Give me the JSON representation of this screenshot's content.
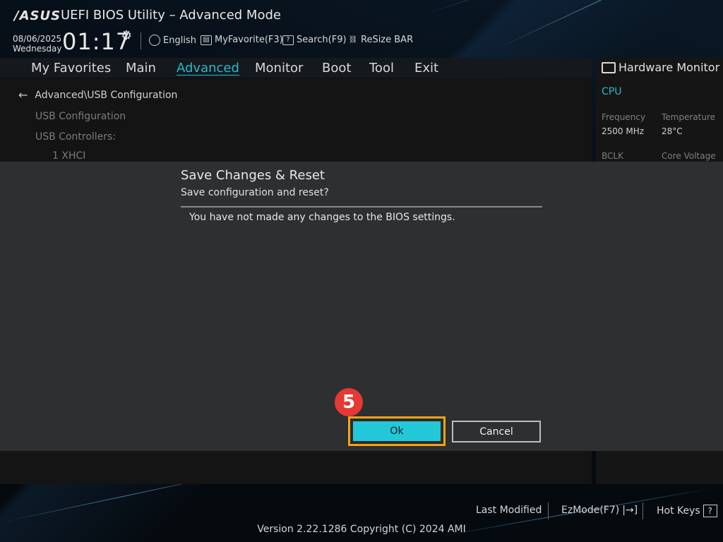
{
  "header": {
    "logo": "/ASUS",
    "title": "UEFI BIOS Utility – Advanced Mode",
    "date": "08/06/2025",
    "weekday": "Wednesday",
    "time": "01:17",
    "language": "English",
    "myfavorite": "MyFavorite(F3)",
    "search": "Search(F9)",
    "resize_bar": "ReSize BAR"
  },
  "nav": {
    "items": [
      "My Favorites",
      "Main",
      "Advanced",
      "Monitor",
      "Boot",
      "Tool",
      "Exit"
    ],
    "active": "Advanced"
  },
  "main": {
    "breadcrumb": "Advanced\\USB Configuration",
    "lines": [
      "USB Configuration",
      "USB Controllers:",
      "1 XHCI"
    ]
  },
  "hardware_monitor": {
    "title": "Hardware Monitor",
    "section": "CPU",
    "frequency_label": "Frequency",
    "frequency_value": "2500 MHz",
    "temperature_label": "Temperature",
    "temperature_value": "28°C",
    "bclk_label": "BCLK",
    "core_voltage_label": "Core Voltage"
  },
  "dialog": {
    "title": "Save Changes & Reset",
    "subtitle": "Save configuration and reset?",
    "message": "You have not made any changes to the BIOS settings.",
    "ok_label": "Ok",
    "cancel_label": "Cancel",
    "step_number": "5"
  },
  "footer": {
    "last_modified": "Last Modified",
    "ezmode": "EzMode(F7)",
    "hot_keys": "Hot Keys",
    "version": "Version 2.22.1286 Copyright (C) 2024 AMI"
  },
  "colors": {
    "accent": "#27b9cc",
    "ok_fill": "#22c8d8",
    "highlight": "#f4a216",
    "badge": "#e53935"
  }
}
